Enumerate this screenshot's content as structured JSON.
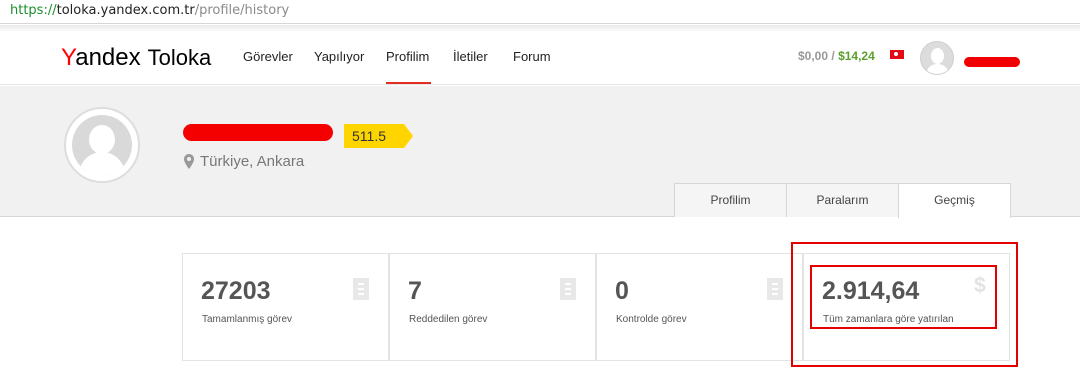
{
  "browser": {
    "url_scheme": "https://",
    "url_host": "toloka.yandex.com.tr",
    "url_path": "/profile/history"
  },
  "header": {
    "logo_first_letter": "Y",
    "logo_rest": "andex",
    "logo_product": "Toloka",
    "nav": [
      "Görevler",
      "Yapılıyor",
      "Profilim",
      "İletiler",
      "Forum"
    ],
    "active_nav": "Profilim",
    "balance_pending": "$0,00",
    "balance_separator": "/",
    "balance_earned": "$14,24",
    "flag": "turkey-flag",
    "avatar_icon": "user-avatar-icon"
  },
  "profile": {
    "rating": "511.5",
    "location": "Türkiye, Ankara",
    "location_icon": "location-pin-icon",
    "avatar_icon": "user-avatar-icon"
  },
  "tabs": [
    {
      "label": "Profilim"
    },
    {
      "label": "Paralarım"
    },
    {
      "label": "Geçmiş"
    }
  ],
  "active_tab": "Geçmiş",
  "stats": [
    {
      "value": "27203",
      "label": "Tamamlanmış görev",
      "icon": "document-icon"
    },
    {
      "value": "7",
      "label": "Reddedilen görev",
      "icon": "document-icon"
    },
    {
      "value": "0",
      "label": "Kontrolde görev",
      "icon": "document-icon"
    },
    {
      "value": "2.914,64",
      "label": "Tüm zamanlara göre yatırılan",
      "icon": "dollar-icon"
    }
  ],
  "colors": {
    "accent_red": "#e32d20",
    "highlight_red": "#e50000",
    "rating_yellow": "#ffd500",
    "earned_green": "#5aa02c"
  }
}
